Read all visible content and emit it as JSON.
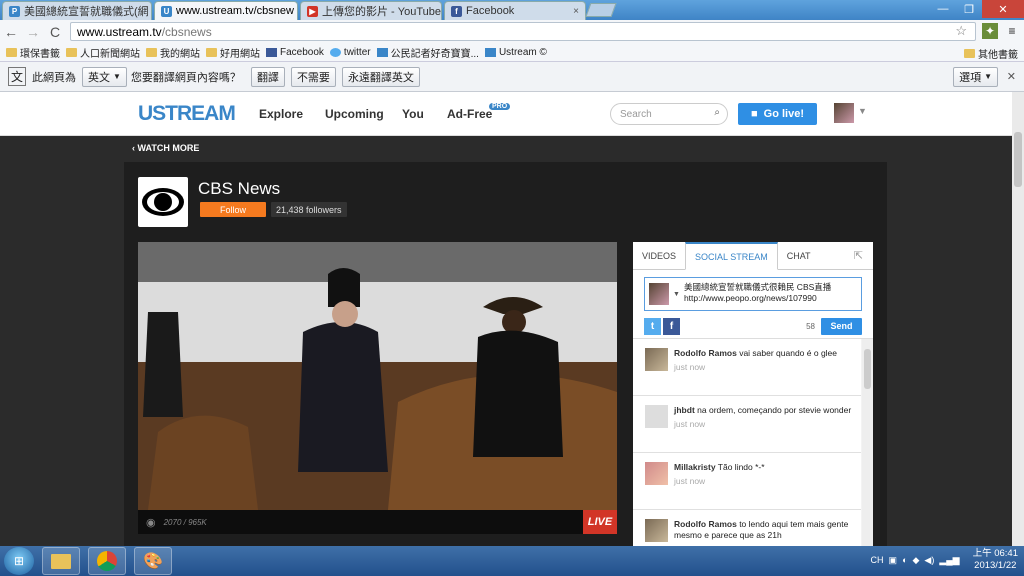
{
  "browser": {
    "tabs": [
      {
        "label": "美國總統宣誓就職儀式(網",
        "favicon": "P",
        "color": "#3a86c8"
      },
      {
        "label": "www.ustream.tv/cbsnew",
        "favicon": "U",
        "color": "#3a86c8"
      },
      {
        "label": "上傳您的影片 - YouTube",
        "favicon": "▶",
        "color": "#d23527"
      },
      {
        "label": "Facebook",
        "favicon": "f",
        "color": "#3b5998"
      }
    ],
    "close_glyph": "×",
    "window_controls": {
      "minimize": "—",
      "maximize": "❐",
      "close": "✕"
    },
    "url_domain": "www.ustream.tv",
    "url_path": "/cbsnews",
    "nav": {
      "back": "←",
      "forward": "→",
      "reload": "C"
    }
  },
  "bookmarks": {
    "items": [
      "環保書籤",
      "人口新聞網站",
      "我的網站",
      "好用網站",
      "Facebook",
      "twitter",
      "公民記者好奇寶寶...",
      "Ustream ©"
    ],
    "other": "其他書籤"
  },
  "translate_bar": {
    "prefix": "此網頁為",
    "language": "英文",
    "question": "您要翻譯網頁內容嗎？",
    "translate": "翻譯",
    "nope": "不需要",
    "always": "永遠翻譯英文",
    "options": "選項"
  },
  "ustream": {
    "logo": "USTREAM",
    "nav": [
      "Explore",
      "Upcoming",
      "You",
      "Ad-Free"
    ],
    "pro_badge": "PRO",
    "search_placeholder": "Search",
    "go_live": "Go live!",
    "watch_more": "WATCH MORE",
    "channel_title": "CBS News",
    "follow": "Follow",
    "followers": "21,438 followers",
    "viewers": "2070 / 965K",
    "live": "LIVE"
  },
  "social": {
    "tabs": [
      "VIDEOS",
      "SOCIAL STREAM",
      "CHAT"
    ],
    "compose_text": "美國總統宣誓就職儀式很賴民 CBS直播http://www.peopo.org/news/107990",
    "char_count": "58",
    "send": "Send",
    "posts": [
      {
        "user": "Rodolfo Ramos",
        "text": "vai saber quando é o glee",
        "time": "just now"
      },
      {
        "user": "jhbdt",
        "text": "na ordem, começando por stevie wonder",
        "time": "just now"
      },
      {
        "user": "Millakristy",
        "text": "Tão lindo *-*",
        "time": "just now"
      },
      {
        "user": "Rodolfo Ramos",
        "text": "to lendo aqui tem mais gente mesmo e parece que as 21h",
        "time": ""
      }
    ]
  },
  "taskbar": {
    "lang": "CH",
    "time": "上午 06:41",
    "date": "2013/1/22"
  }
}
